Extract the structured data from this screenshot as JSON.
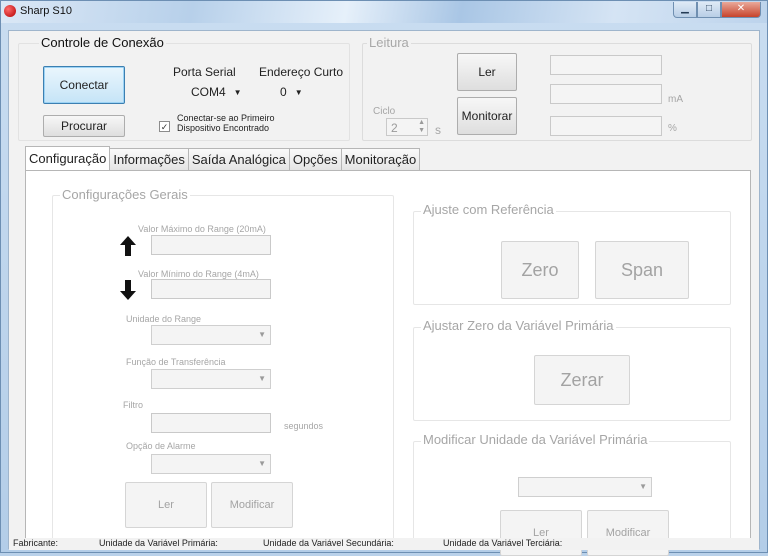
{
  "window": {
    "title": "Sharp S10"
  },
  "connection": {
    "title": "Controle de Conexão",
    "connect_label": "Conectar",
    "search_label": "Procurar",
    "serial_port_label": "Porta Serial",
    "serial_port_value": "COM4",
    "short_address_label": "Endereço Curto",
    "short_address_value": "0",
    "auto_connect_label": "Conectar-se ao Primeiro\nDispositivo Encontrado",
    "auto_connect_checked": true
  },
  "reading": {
    "title": "Leitura",
    "read_label": "Ler",
    "monitor_label": "Monitorar",
    "cycle_label": "Ciclo",
    "cycle_value": "2",
    "cycle_unit": "s",
    "unit_ma": "mA",
    "unit_percent": "%"
  },
  "tabs": [
    "Configuração",
    "Informações",
    "Saída Analógica",
    "Opções",
    "Monitoração"
  ],
  "general": {
    "title": "Configurações Gerais",
    "max_range_label": "Valor Máximo do Range (20mA)",
    "min_range_label": "Valor Mínimo do Range (4mA)",
    "range_unit_label": "Unidade do Range",
    "transfer_function_label": "Função de Transferência",
    "filter_label": "Filtro",
    "filter_unit": "segundos",
    "alarm_option_label": "Opção de Alarme",
    "read_label": "Ler",
    "modify_label": "Modificar"
  },
  "reference": {
    "title": "Ajuste com Referência",
    "zero_label": "Zero",
    "span_label": "Span"
  },
  "primary_zero": {
    "title": "Ajustar Zero da Variável Primária",
    "reset_label": "Zerar"
  },
  "primary_unit": {
    "title": "Modificar Unidade da Variável Primária",
    "read_label": "Ler",
    "modify_label": "Modificar"
  },
  "status": {
    "manufacturer": "Fabricante:",
    "primary_unit": "Unidade da Variável Primária:",
    "secondary_unit": "Unidade da Variável Secundária:",
    "tertiary_unit": "Unidade da Variável Terciária:"
  },
  "icons": {
    "up": "up-arrow-icon",
    "down": "down-arrow-icon"
  }
}
